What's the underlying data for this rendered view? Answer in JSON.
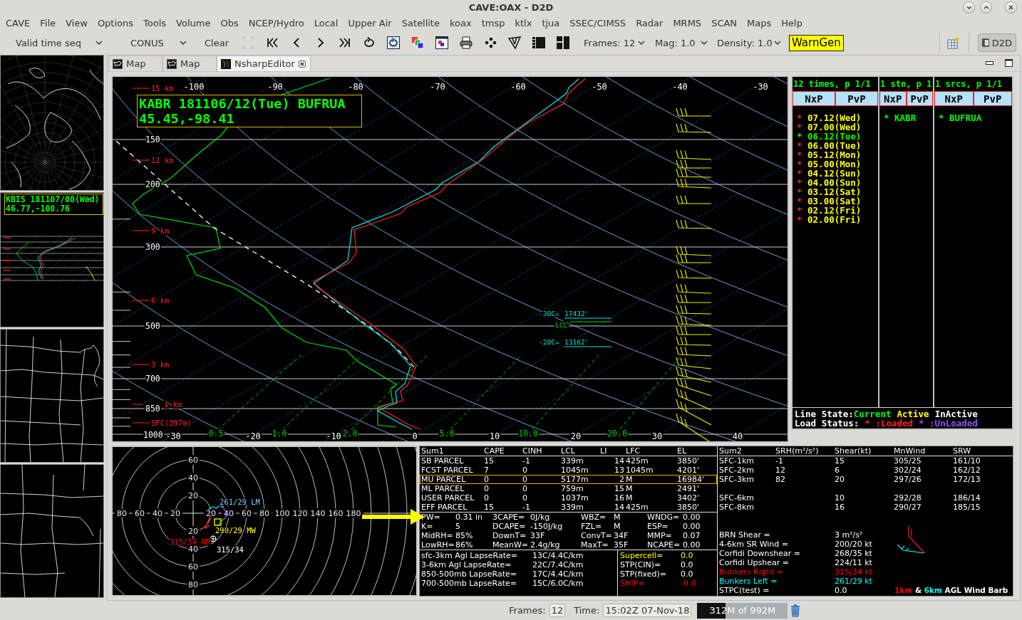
{
  "window": {
    "title": "CAVE:OAX - D2D"
  },
  "menu": [
    "CAVE",
    "File",
    "View",
    "Options",
    "Tools",
    "Volume",
    "Obs",
    "NCEP/Hydro",
    "Local",
    "Upper Air",
    "Satellite",
    "koax",
    "tmsp",
    "ktlx",
    "tjua",
    "SSEC/CIMSS",
    "Radar",
    "MRMS",
    "SCAN",
    "Maps",
    "Help"
  ],
  "toolbar": {
    "selectors": [
      {
        "label": "Valid time seq"
      },
      {
        "label": "CONUS"
      }
    ],
    "clear": "Clear",
    "tools": [
      {
        "kind": "fullscreen",
        "disabled": true
      },
      {
        "kind": "first",
        "disabled": false
      },
      {
        "kind": "previous",
        "disabled": false
      },
      {
        "kind": "next",
        "disabled": false
      },
      {
        "kind": "last",
        "disabled": false
      },
      {
        "kind": "loop",
        "disabled": false
      },
      {
        "kind": "loopsettings",
        "disabled": false
      },
      {
        "kind": "combine",
        "disabled": false
      },
      {
        "kind": "imageprops",
        "disabled": false
      },
      {
        "kind": "print",
        "disabled": false
      },
      {
        "kind": "points",
        "disabled": false
      },
      {
        "kind": "sketch",
        "disabled": false
      },
      {
        "kind": "layoutsingle",
        "disabled": false
      },
      {
        "kind": "layoutfour",
        "disabled": false
      }
    ],
    "options": [
      {
        "label": "Frames: 12"
      },
      {
        "label": "Mag: 1.0"
      },
      {
        "label": "Density: 1.0"
      }
    ],
    "warngen": "WarnGen",
    "perspective": {
      "label": "D2D",
      "selected": true
    }
  },
  "side_panels": [
    {
      "kind": "worldmap"
    },
    {
      "kind": "skewt",
      "header": [
        "KBIS 181107/00(Wed)",
        "46.77,-100.76"
      ]
    },
    {
      "kind": "statesmap"
    },
    {
      "kind": "plainsmap"
    }
  ],
  "tabs": [
    {
      "kind": "map",
      "label": "Map",
      "selected": false,
      "closable": false
    },
    {
      "kind": "map",
      "label": "Map",
      "selected": false,
      "closable": false
    },
    {
      "kind": "nsharp",
      "label": "NsharpEditor",
      "selected": true,
      "closable": true
    }
  ],
  "skewt": {
    "station_header": [
      "KABR 181106/12(Tue) BUFRUA",
      "45.45,-98.41"
    ],
    "top_temperature_labels": [
      "-100",
      "-90",
      "-80",
      "-70",
      "-60",
      "-50",
      "-40",
      "-30"
    ],
    "bottom_temperature_labels": [
      "-30",
      "-20",
      "-10",
      "0",
      "10",
      "20",
      "30",
      "40"
    ],
    "pressure_labels": [
      "150",
      "200",
      "300",
      "500",
      "700",
      "850",
      "1000"
    ],
    "height_labels": [
      "15 km",
      "12 km",
      "9 km",
      "6 km",
      "3 km",
      "1 km",
      "SFC(397m)"
    ],
    "mixing_ratio_labels": [
      "0.5",
      "1.0",
      "2.0",
      "5.0",
      "10.0",
      "20.0"
    ],
    "level_annotations": [
      {
        "kind": "isotherm",
        "label": "-30C=",
        "value": "17432'"
      },
      {
        "kind": "lcl",
        "label": "LCL"
      },
      {
        "kind": "isotherm",
        "label": "-20C=",
        "value": "13162'"
      }
    ]
  },
  "sounding_list": {
    "columns": [
      {
        "title": "12 times, p 1/1",
        "buttons": [
          "NxP",
          "PvP"
        ],
        "items": [
          {
            "marker": "*",
            "label": "07.12(Wed)",
            "current": false
          },
          {
            "marker": "*",
            "label": "07.00(Wed)",
            "current": false
          },
          {
            "marker": "*",
            "label": "06.12(Tue)",
            "current": true
          },
          {
            "marker": "*",
            "label": "06.00(Tue)",
            "current": false
          },
          {
            "marker": "*",
            "label": "05.12(Mon)",
            "current": false
          },
          {
            "marker": "*",
            "label": "05.00(Mon)",
            "current": false
          },
          {
            "marker": "*",
            "label": "04.12(Sun)",
            "current": false
          },
          {
            "marker": "*",
            "label": "04.00(Sun)",
            "current": false
          },
          {
            "marker": "*",
            "label": "03.12(Sat)",
            "current": false
          },
          {
            "marker": "*",
            "label": "03.00(Sat)",
            "current": false
          },
          {
            "marker": "*",
            "label": "02.12(Fri)",
            "current": false
          },
          {
            "marker": "*",
            "label": "02.00(Fri)",
            "current": false
          }
        ]
      },
      {
        "title": "1 stn, p 1",
        "buttons": [
          "NxP",
          "PvP"
        ],
        "items": [
          {
            "marker": "*",
            "label": "KABR",
            "current": true
          }
        ]
      },
      {
        "title": "1 srcs, p 1/1",
        "buttons": [
          "NxP",
          "PvP"
        ],
        "items": [
          {
            "marker": "*",
            "label": "BUFRUA",
            "current": true
          }
        ]
      }
    ],
    "legend": {
      "line_state_label": "Line State:",
      "line_states": [
        {
          "label": "Current",
          "color": "#00ff00"
        },
        {
          "label": "Active",
          "color": "#ffff00"
        },
        {
          "label": "InActive",
          "color": "#ffffff"
        }
      ],
      "load_status_label": "Load Status:",
      "load_states": [
        {
          "marker": "*",
          "label": ":Loaded",
          "color": "#ff2020"
        },
        {
          "marker": "*",
          "label": ":UnLoaded",
          "color": "#9a4cff"
        }
      ]
    }
  },
  "hodograph": {
    "up_labels": [
      "60",
      "40",
      "20"
    ],
    "down_labels": [
      "20",
      "40",
      "60",
      "80"
    ],
    "left_labels": [
      "80",
      "60",
      "40",
      "20"
    ],
    "right_labels": [
      "20",
      "40",
      "60",
      "80",
      "100",
      "120",
      "140",
      "160",
      "180"
    ],
    "annotations": [
      {
        "label": "261/29 LM",
        "color": "#80c8ff"
      },
      {
        "label": "290/29 MW",
        "color": "#ffff00"
      },
      {
        "label": "315/34 RM",
        "color": "#ff0000"
      },
      {
        "label": "315/34",
        "color": "#ffffff"
      }
    ]
  },
  "summary": {
    "parcel_table": {
      "columns": [
        "Sum1",
        "CAPE",
        "CINH",
        "LCL",
        "LI",
        "LFC",
        "EL"
      ],
      "rows": [
        {
          "cells": [
            "SB PARCEL",
            "15",
            "-1",
            "339m",
            "14",
            "425m",
            "3850'"
          ],
          "selected": false
        },
        {
          "cells": [
            "FCST PARCEL",
            "7",
            "0",
            "1045m",
            "13",
            "1045m",
            "4201'"
          ],
          "selected": false
        },
        {
          "cells": [
            "MU PARCEL",
            "0",
            "0",
            "5177m",
            "2",
            "M",
            "16984'"
          ],
          "selected": true
        },
        {
          "cells": [
            "ML PARCEL",
            "0",
            "0",
            "759m",
            "15",
            "M",
            "2491'"
          ],
          "selected": false
        },
        {
          "cells": [
            "USER PARCEL",
            "0",
            "0",
            "1037m",
            "16",
            "M",
            "3402'"
          ],
          "selected": false
        },
        {
          "cells": [
            "EFF PARCEL",
            "15",
            "-1",
            "339m",
            "14",
            "425m",
            "3850'"
          ],
          "selected": false
        }
      ]
    },
    "indices": [
      {
        "items": [
          {
            "label": "PW=",
            "value": "0.31 in"
          },
          {
            "label": "3CAPE=",
            "value": "0J/kg"
          },
          {
            "label": "WBZ=",
            "value": "M"
          },
          {
            "label": "WNDG=",
            "value": "0.00"
          }
        ]
      },
      {
        "items": [
          {
            "label": "K=",
            "value": "5"
          },
          {
            "label": "DCAPE=",
            "value": "-150J/kg"
          },
          {
            "label": "FZL=",
            "value": "M"
          },
          {
            "label": "ESP=",
            "value": "0.00"
          }
        ]
      },
      {
        "items": [
          {
            "label": "MidRH=",
            "value": "85%"
          },
          {
            "label": "DownT=",
            "value": "33F"
          },
          {
            "label": "ConvT=",
            "value": "34F"
          },
          {
            "label": "MMP=",
            "value": "0.07"
          }
        ]
      },
      {
        "items": [
          {
            "label": "LowRH=",
            "value": "86%"
          },
          {
            "label": "MeanW=",
            "value": "2.4g/kg"
          },
          {
            "label": "MaxT=",
            "value": "35F"
          },
          {
            "label": "NCAPE=",
            "value": "0.00"
          }
        ]
      }
    ],
    "lapse_rates": [
      {
        "label": "sfc-3km Agl LapseRate=",
        "value": "13C/4.4C/km"
      },
      {
        "label": "3-6km Agl LapseRate=",
        "value": "22C/7.4C/km"
      },
      {
        "label": "850-500mb LapseRate=",
        "value": "17C/4.4C/km"
      },
      {
        "label": "700-500mb LapseRate=",
        "value": "15C/6.0C/km"
      }
    ],
    "composites": [
      {
        "label": "Supercell=",
        "value": "0.0",
        "color": "#ffff00"
      },
      {
        "label": "STP(CIN)=",
        "value": "0.0",
        "color": "#ffffff"
      },
      {
        "label": "STP(fixed)=",
        "value": "0.0",
        "color": "#ffffff"
      },
      {
        "label": "SHIP=",
        "value": "-0.0",
        "color": "#ff0000"
      }
    ],
    "shear_table": {
      "columns": [
        "Sum2",
        "SRH(m²/s²)",
        "Shear(kt)",
        "MnWind",
        "SRW"
      ],
      "rows": [
        {
          "layer": "SFC-1km",
          "srh": "-1",
          "shear": "15",
          "mean_wind": "305/25",
          "srw": "161/10"
        },
        {
          "layer": "SFC-2km",
          "srh": "12",
          "shear": "6",
          "mean_wind": "302/24",
          "srw": "162/12"
        },
        {
          "layer": "SFC-3km",
          "srh": "82",
          "shear": "20",
          "mean_wind": "297/26",
          "srw": "172/13"
        },
        {
          "layer": "SFC-6km",
          "shear": "10",
          "mean_wind": "292/28",
          "srw": "186/14"
        },
        {
          "layer": "SFC-8km",
          "shear": "16",
          "mean_wind": "290/27",
          "srw": "185/15"
        }
      ]
    },
    "wind_params": [
      {
        "label": "BRN Shear =",
        "value": "3 m²/s²",
        "color": "#ffffff"
      },
      {
        "label": "4-6km SR Wind =",
        "value": "200/20 kt",
        "color": "#ffffff"
      },
      {
        "label": "Corfidi Downshear =",
        "value": "268/35 kt",
        "color": "#ffffff"
      },
      {
        "label": "Corfidi Upshear =",
        "value": "224/11 kt",
        "color": "#ffffff"
      },
      {
        "label": "Bunkers Right =",
        "value": "315/34 kt",
        "color": "#ff0000"
      },
      {
        "label": "Bunkers Left =",
        "value": "261/29 kt",
        "color": "#00ffff"
      },
      {
        "label": "STPC(test) =",
        "value": "0.0",
        "color": "#ffffff"
      }
    ],
    "barb_legend": [
      {
        "text": "1km",
        "color": "#ff0000"
      },
      {
        "text": "&",
        "color": "#ffffff"
      },
      {
        "text": "6km",
        "color": "#00ffff"
      },
      {
        "text": "AGL Wind Barb",
        "color": "#ffffff"
      }
    ]
  },
  "status_bar": {
    "frames_label": "Frames:",
    "frames_value": "12",
    "time_label": "Time:",
    "time_value": "15:02Z 07-Nov-18",
    "memory": {
      "label": "312M of 992M",
      "level": 0.31
    }
  }
}
